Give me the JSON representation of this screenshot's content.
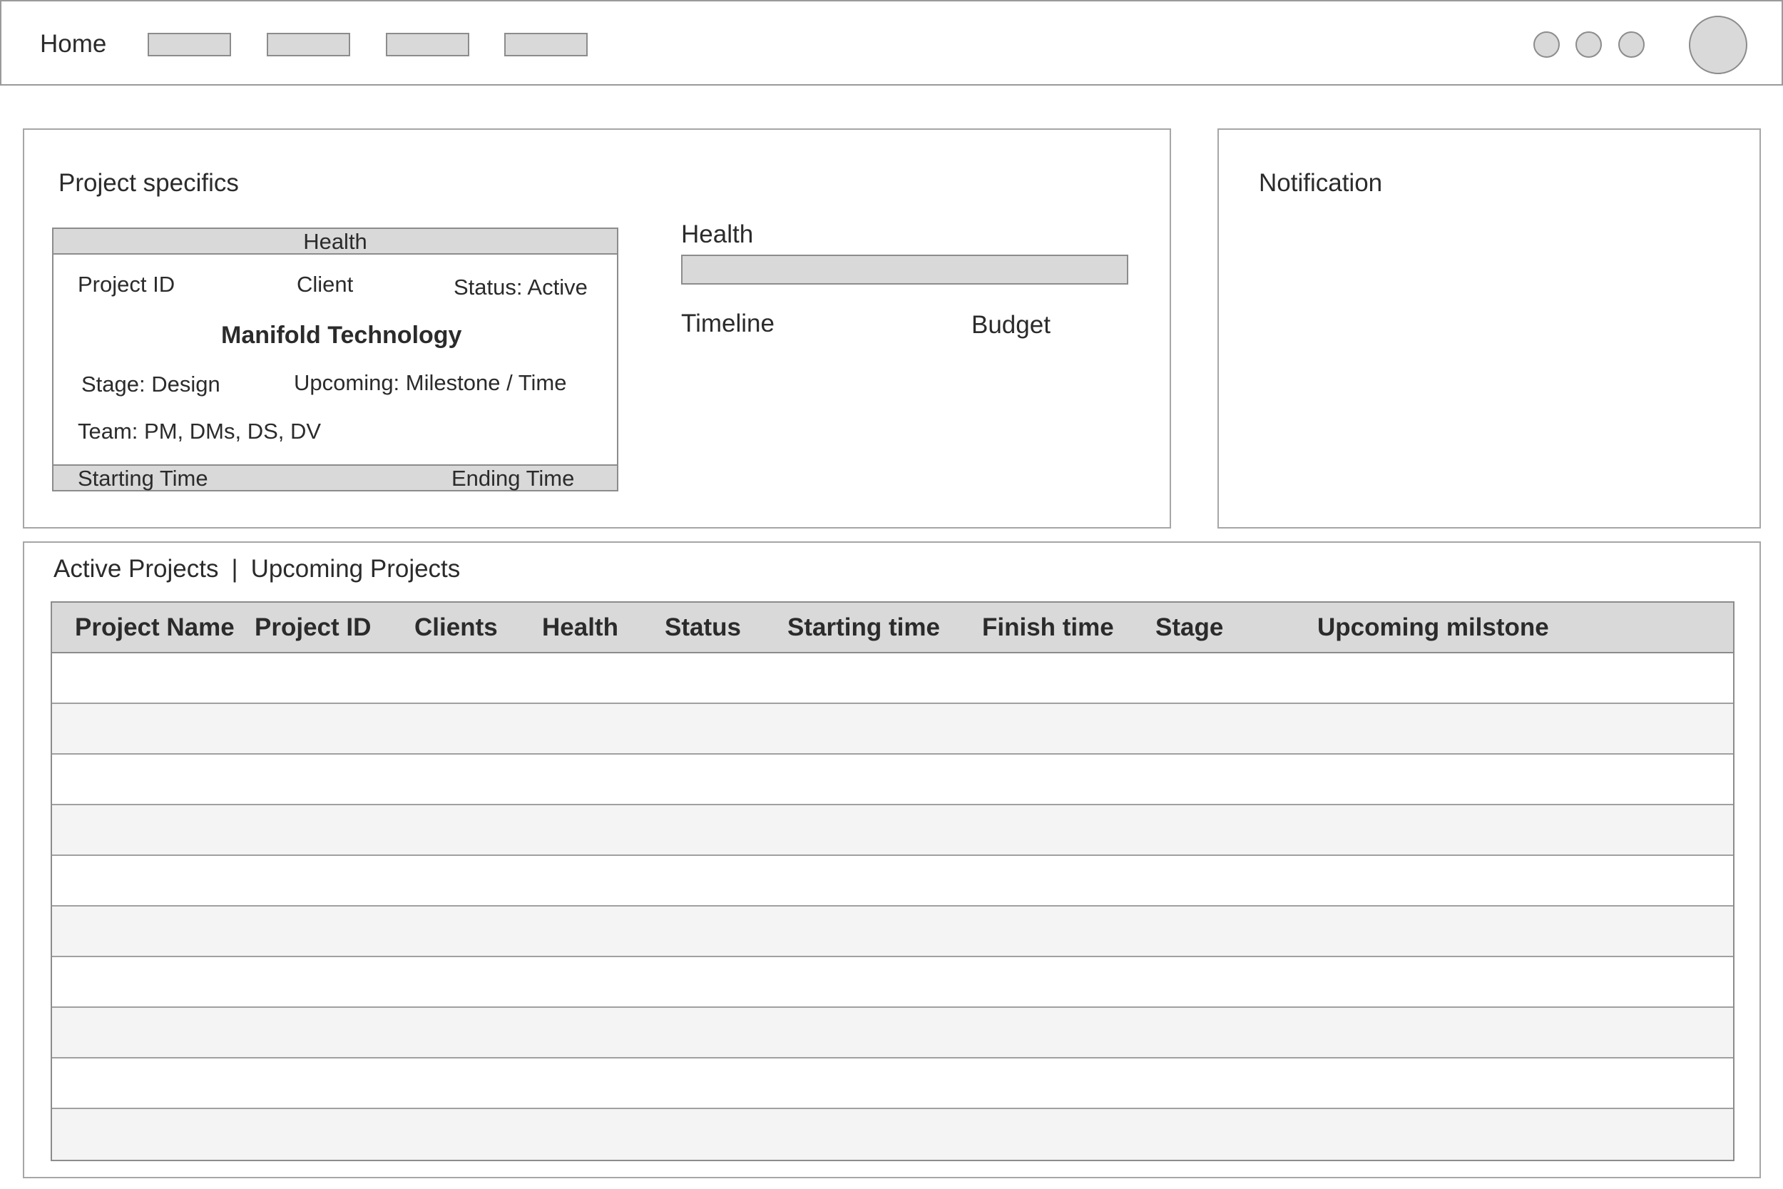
{
  "nav": {
    "home_label": "Home",
    "placeholder_count": 4,
    "icon_count": 3
  },
  "specifics": {
    "title": "Project specifics",
    "card": {
      "header": "Health",
      "project_id_label": "Project ID",
      "client_label": "Client",
      "status": "Status: Active",
      "client_name": "Manifold Technology",
      "stage": "Stage: Design",
      "upcoming": "Upcoming: Milestone / Time",
      "team": "Team: PM, DMs, DS, DV",
      "start_label": "Starting Time",
      "end_label": "Ending Time"
    },
    "health_label": "Health",
    "timeline_label": "Timeline",
    "budget_label": "Budget"
  },
  "notification": {
    "title": "Notification"
  },
  "projects": {
    "tabs": {
      "active": "Active Projects",
      "separator": "|",
      "upcoming": "Upcoming Projects"
    },
    "columns": [
      "Project Name",
      "Project ID",
      "Clients",
      "Health",
      "Status",
      "Starting time",
      "Finish time",
      "Stage",
      "Upcoming milstone"
    ],
    "row_count": 10
  },
  "colors": {
    "placeholder_fill": "#d9d9d9",
    "border": "#8c8c8c",
    "alt_row": "#f4f4f4"
  }
}
